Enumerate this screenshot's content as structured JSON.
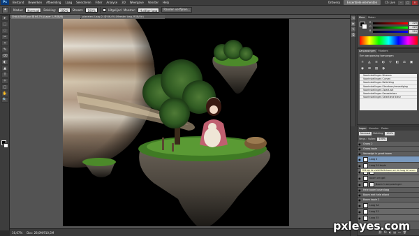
{
  "app": {
    "logo": "Ps",
    "menu": [
      "Bestand",
      "Bewerken",
      "Afbeelding",
      "Laag",
      "Selecteren",
      "Filter",
      "Analyse",
      "3D",
      "Weergave",
      "Venster",
      "Help"
    ],
    "workspace_label": "Ontwerp",
    "essentials_button": "Essentiële elementen",
    "cs_live": "CS Live",
    "window_buttons": [
      "–",
      "□",
      "×"
    ]
  },
  "options": {
    "tool_glyph": "✦",
    "mode_label": "Modus:",
    "mode_value": "Normaal",
    "opacity_label": "Dekking:",
    "opacity_value": "100%",
    "flow_label": "Stroom:",
    "flow_value": "100%",
    "sample_label": "Uitgelijnd",
    "sample_all_label": "Monster:",
    "sample_value": "Huidige laag",
    "refine_button": "Randen verfijnen..."
  },
  "tools": [
    "▸",
    "⬚",
    "◌",
    "✂",
    "⌖",
    "✎",
    "⌫",
    "◐",
    "▲",
    "T",
    "✧",
    "□",
    "✋",
    "🔍"
  ],
  "document": {
    "tab_label": "CHALLENGE.psd @ 66,7% (Layer 1, RGB/8)",
    "tab2_label": "planeten (Laag 2) @ 66,4% (Meester laag, RGB/8#)"
  },
  "status": {
    "zoom": "16,67%",
    "doc_size": "Doc: 28,0M/910,5M"
  },
  "color_panel": {
    "tabs": [
      "Kleur",
      "Stalen"
    ],
    "channels": [
      "R",
      "G",
      "B"
    ],
    "values": [
      "220",
      "220",
      "220"
    ]
  },
  "adjust_panel": {
    "tabs": [
      "Aanpassingen",
      "Maskers"
    ],
    "title": "Een aanpassing toevoegen",
    "icons": [
      "☼",
      "◭",
      "≡",
      "◐",
      "▽",
      "◧",
      "⚖",
      "▣",
      "◉",
      "⊞",
      "▤",
      "◑"
    ],
    "presets": [
      "Voorinstellingen Niveaus",
      "Voorinstellingen Curven",
      "Voorinstellingen Belichting",
      "Voorinstellingen Kleurtoon/verzadiging",
      "Voorinstellingen Zwart-wit",
      "Voorinstellingen Kanaalmixer",
      "Voorinstellingen Selectieve kleur"
    ]
  },
  "layers_panel": {
    "tabs": [
      "Lagen",
      "Kanalen",
      "Paden"
    ],
    "blend_mode": "Normaal",
    "opacity_label": "Dekking:",
    "opacity_value": "100%",
    "lock_label": "Vergr.:",
    "fill_label": "Vullen:",
    "fill_value": "100%",
    "tooltip": "Klik op de visibiliteitsicoon om de laag te tonen",
    "layers": [
      {
        "name": "Groep 2",
        "type": "group"
      },
      {
        "name": "Groep kopie",
        "type": "group"
      },
      {
        "name": "Vermelgd in groot boom",
        "type": "group"
      },
      {
        "name": "Laag 4",
        "type": "layer",
        "selected": true
      },
      {
        "name": "Laag 24 kopie",
        "type": "layer"
      },
      {
        "name": "boom om gat kopie",
        "type": "layer"
      },
      {
        "name": "boom om gat",
        "type": "layer"
      },
      {
        "name": "Boom 1 aanpassingen",
        "type": "layer"
      },
      {
        "name": "Hele boom bovenlaag",
        "type": "group"
      },
      {
        "name": "Boom met hele eiland",
        "type": "group"
      },
      {
        "name": "Boom kopie 2",
        "type": "group"
      },
      {
        "name": "Laag 3A",
        "type": "layer"
      },
      {
        "name": "Laag 33",
        "type": "layer"
      },
      {
        "name": "Laag 35",
        "type": "layer"
      }
    ],
    "footer_icons": [
      "⛓",
      "fx",
      "◐",
      "▤",
      "▭",
      "🗑"
    ]
  },
  "watermark": {
    "text": "pxleyes",
    "suffix": ".com"
  }
}
